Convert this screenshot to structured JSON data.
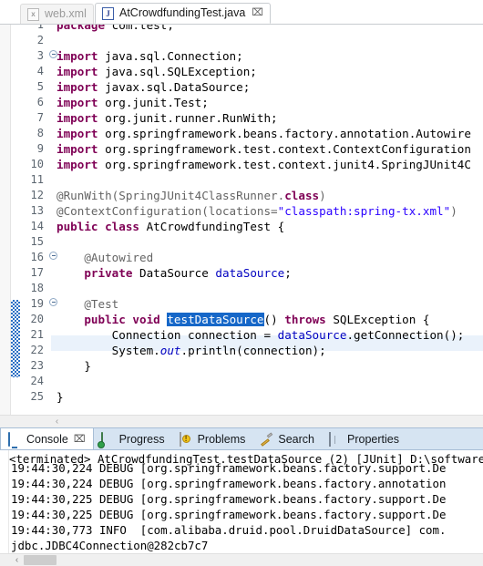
{
  "editor": {
    "tabs": [
      {
        "label": "web.xml",
        "icon": "xml-file-icon",
        "active": false,
        "closable": false
      },
      {
        "label": "AtCrowdfundingTest.java",
        "icon": "java-file-icon",
        "active": true,
        "closable": true,
        "close_glyph": "⌧"
      }
    ],
    "first_visible_line": 1,
    "last_visible_line": 25,
    "selection": "testDataSource",
    "caret_line": 20,
    "occurrence_marker_lines": [
      19,
      23
    ],
    "fold_lines": [
      3,
      16,
      19
    ],
    "lines": [
      {
        "n": 1,
        "clipped": true,
        "tokens": [
          {
            "t": "package",
            "c": "kw"
          },
          {
            "t": " com.test;",
            "c": ""
          }
        ]
      },
      {
        "n": 2,
        "tokens": []
      },
      {
        "n": 3,
        "tokens": [
          {
            "t": "import",
            "c": "kw"
          },
          {
            "t": " java.sql.Connection;",
            "c": ""
          }
        ]
      },
      {
        "n": 4,
        "tokens": [
          {
            "t": "import",
            "c": "kw"
          },
          {
            "t": " java.sql.SQLException;",
            "c": ""
          }
        ]
      },
      {
        "n": 5,
        "tokens": [
          {
            "t": "import",
            "c": "kw"
          },
          {
            "t": " javax.sql.DataSource;",
            "c": ""
          }
        ]
      },
      {
        "n": 6,
        "tokens": [
          {
            "t": "import",
            "c": "kw"
          },
          {
            "t": " org.junit.Test;",
            "c": ""
          }
        ]
      },
      {
        "n": 7,
        "tokens": [
          {
            "t": "import",
            "c": "kw"
          },
          {
            "t": " org.junit.runner.RunWith;",
            "c": ""
          }
        ]
      },
      {
        "n": 8,
        "tokens": [
          {
            "t": "import",
            "c": "kw"
          },
          {
            "t": " org.springframework.beans.factory.annotation.Autowire",
            "c": ""
          }
        ]
      },
      {
        "n": 9,
        "tokens": [
          {
            "t": "import",
            "c": "kw"
          },
          {
            "t": " org.springframework.test.context.ContextConfiguration",
            "c": ""
          }
        ]
      },
      {
        "n": 10,
        "tokens": [
          {
            "t": "import",
            "c": "kw"
          },
          {
            "t": " org.springframework.test.context.junit4.SpringJUnit4C",
            "c": ""
          }
        ]
      },
      {
        "n": 11,
        "tokens": []
      },
      {
        "n": 12,
        "tokens": [
          {
            "t": "@RunWith(SpringJUnit4ClassRunner.",
            "c": "ann"
          },
          {
            "t": "class",
            "c": "kw"
          },
          {
            "t": ")",
            "c": "ann"
          }
        ]
      },
      {
        "n": 13,
        "tokens": [
          {
            "t": "@ContextConfiguration(locations=",
            "c": "ann"
          },
          {
            "t": "\"classpath:spring-tx.xml\"",
            "c": "str"
          },
          {
            "t": ")",
            "c": "ann"
          }
        ]
      },
      {
        "n": 14,
        "tokens": [
          {
            "t": "public class",
            "c": "kw"
          },
          {
            "t": " AtCrowdfundingTest {",
            "c": ""
          }
        ]
      },
      {
        "n": 15,
        "tokens": []
      },
      {
        "n": 16,
        "tokens": [
          {
            "t": "    @Autowired",
            "c": "ann"
          }
        ]
      },
      {
        "n": 17,
        "tokens": [
          {
            "t": "    ",
            "c": ""
          },
          {
            "t": "private",
            "c": "kw"
          },
          {
            "t": " DataSource ",
            "c": ""
          },
          {
            "t": "dataSource",
            "c": "fld"
          },
          {
            "t": ";",
            "c": ""
          }
        ]
      },
      {
        "n": 18,
        "tokens": []
      },
      {
        "n": 19,
        "tokens": [
          {
            "t": "    @Test",
            "c": "ann"
          }
        ]
      },
      {
        "n": 20,
        "highlight": true,
        "tokens": [
          {
            "t": "    ",
            "c": ""
          },
          {
            "t": "public void",
            "c": "kw"
          },
          {
            "t": " ",
            "c": ""
          },
          {
            "t": "testDataSource",
            "c": "sel"
          },
          {
            "t": "() ",
            "c": ""
          },
          {
            "t": "throws",
            "c": "kw"
          },
          {
            "t": " SQLException {",
            "c": ""
          }
        ]
      },
      {
        "n": 21,
        "tokens": [
          {
            "t": "        Connection connection = ",
            "c": ""
          },
          {
            "t": "dataSource",
            "c": "fld"
          },
          {
            "t": ".getConnection();",
            "c": ""
          }
        ]
      },
      {
        "n": 22,
        "tokens": [
          {
            "t": "        System.",
            "c": ""
          },
          {
            "t": "out",
            "c": "stat"
          },
          {
            "t": ".println(connection);",
            "c": ""
          }
        ]
      },
      {
        "n": 23,
        "tokens": [
          {
            "t": "    }",
            "c": ""
          }
        ]
      },
      {
        "n": 24,
        "tokens": []
      },
      {
        "n": 25,
        "tokens": [
          {
            "t": "}",
            "c": ""
          }
        ]
      }
    ],
    "hscroll_left_glyph": "‹"
  },
  "console": {
    "tabs": [
      {
        "label": "Console",
        "icon": "console-icon",
        "active": true,
        "closable": true,
        "close_glyph": "⌧"
      },
      {
        "label": "Progress",
        "icon": "progress-icon",
        "active": false,
        "closable": false
      },
      {
        "label": "Problems",
        "icon": "problems-icon",
        "active": false,
        "closable": false
      },
      {
        "label": "Search",
        "icon": "search-icon",
        "active": false,
        "closable": false
      },
      {
        "label": "Properties",
        "icon": "properties-icon",
        "active": false,
        "closable": false
      }
    ],
    "header": "<terminated> AtCrowdfundingTest.testDataSource (2) [JUnit] D:\\software\\JDK\\bin\\javaw.e",
    "output_lines": [
      "19:44:30,224 DEBUG [org.springframework.beans.factory.support.De",
      "19:44:30,224 DEBUG [org.springframework.beans.factory.annotation",
      "19:44:30,225 DEBUG [org.springframework.beans.factory.support.De",
      "19:44:30,225 DEBUG [org.springframework.beans.factory.support.De",
      "19:44:30,773 INFO  [com.alibaba.druid.pool.DruidDataSource] com.",
      "jdbc.JDBC4Connection@282cb7c7"
    ],
    "hscroll_left_glyph": "‹"
  },
  "colors": {
    "keyword": "#7f0055",
    "string": "#2a00ff",
    "field": "#0000c0",
    "annotation": "#646464",
    "selection_bg": "#1667c8",
    "caret_row_bg": "#eaf2fb",
    "occurrence_marker": "#2a6fc4",
    "console_tabbar_bg": "#d6e4f2"
  }
}
